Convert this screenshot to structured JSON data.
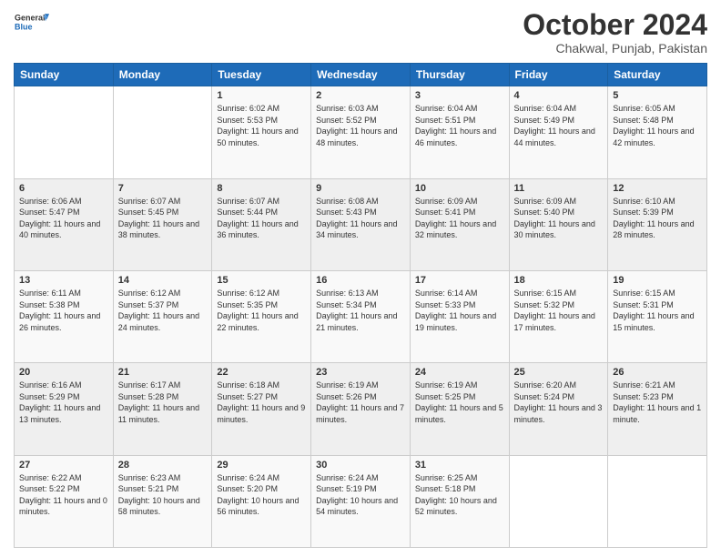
{
  "header": {
    "logo_general": "General",
    "logo_blue": "Blue",
    "month_title": "October 2024",
    "location": "Chakwal, Punjab, Pakistan"
  },
  "weekdays": [
    "Sunday",
    "Monday",
    "Tuesday",
    "Wednesday",
    "Thursday",
    "Friday",
    "Saturday"
  ],
  "weeks": [
    [
      {
        "day": "",
        "sunrise": "",
        "sunset": "",
        "daylight": ""
      },
      {
        "day": "",
        "sunrise": "",
        "sunset": "",
        "daylight": ""
      },
      {
        "day": "1",
        "sunrise": "Sunrise: 6:02 AM",
        "sunset": "Sunset: 5:53 PM",
        "daylight": "Daylight: 11 hours and 50 minutes."
      },
      {
        "day": "2",
        "sunrise": "Sunrise: 6:03 AM",
        "sunset": "Sunset: 5:52 PM",
        "daylight": "Daylight: 11 hours and 48 minutes."
      },
      {
        "day": "3",
        "sunrise": "Sunrise: 6:04 AM",
        "sunset": "Sunset: 5:51 PM",
        "daylight": "Daylight: 11 hours and 46 minutes."
      },
      {
        "day": "4",
        "sunrise": "Sunrise: 6:04 AM",
        "sunset": "Sunset: 5:49 PM",
        "daylight": "Daylight: 11 hours and 44 minutes."
      },
      {
        "day": "5",
        "sunrise": "Sunrise: 6:05 AM",
        "sunset": "Sunset: 5:48 PM",
        "daylight": "Daylight: 11 hours and 42 minutes."
      }
    ],
    [
      {
        "day": "6",
        "sunrise": "Sunrise: 6:06 AM",
        "sunset": "Sunset: 5:47 PM",
        "daylight": "Daylight: 11 hours and 40 minutes."
      },
      {
        "day": "7",
        "sunrise": "Sunrise: 6:07 AM",
        "sunset": "Sunset: 5:45 PM",
        "daylight": "Daylight: 11 hours and 38 minutes."
      },
      {
        "day": "8",
        "sunrise": "Sunrise: 6:07 AM",
        "sunset": "Sunset: 5:44 PM",
        "daylight": "Daylight: 11 hours and 36 minutes."
      },
      {
        "day": "9",
        "sunrise": "Sunrise: 6:08 AM",
        "sunset": "Sunset: 5:43 PM",
        "daylight": "Daylight: 11 hours and 34 minutes."
      },
      {
        "day": "10",
        "sunrise": "Sunrise: 6:09 AM",
        "sunset": "Sunset: 5:41 PM",
        "daylight": "Daylight: 11 hours and 32 minutes."
      },
      {
        "day": "11",
        "sunrise": "Sunrise: 6:09 AM",
        "sunset": "Sunset: 5:40 PM",
        "daylight": "Daylight: 11 hours and 30 minutes."
      },
      {
        "day": "12",
        "sunrise": "Sunrise: 6:10 AM",
        "sunset": "Sunset: 5:39 PM",
        "daylight": "Daylight: 11 hours and 28 minutes."
      }
    ],
    [
      {
        "day": "13",
        "sunrise": "Sunrise: 6:11 AM",
        "sunset": "Sunset: 5:38 PM",
        "daylight": "Daylight: 11 hours and 26 minutes."
      },
      {
        "day": "14",
        "sunrise": "Sunrise: 6:12 AM",
        "sunset": "Sunset: 5:37 PM",
        "daylight": "Daylight: 11 hours and 24 minutes."
      },
      {
        "day": "15",
        "sunrise": "Sunrise: 6:12 AM",
        "sunset": "Sunset: 5:35 PM",
        "daylight": "Daylight: 11 hours and 22 minutes."
      },
      {
        "day": "16",
        "sunrise": "Sunrise: 6:13 AM",
        "sunset": "Sunset: 5:34 PM",
        "daylight": "Daylight: 11 hours and 21 minutes."
      },
      {
        "day": "17",
        "sunrise": "Sunrise: 6:14 AM",
        "sunset": "Sunset: 5:33 PM",
        "daylight": "Daylight: 11 hours and 19 minutes."
      },
      {
        "day": "18",
        "sunrise": "Sunrise: 6:15 AM",
        "sunset": "Sunset: 5:32 PM",
        "daylight": "Daylight: 11 hours and 17 minutes."
      },
      {
        "day": "19",
        "sunrise": "Sunrise: 6:15 AM",
        "sunset": "Sunset: 5:31 PM",
        "daylight": "Daylight: 11 hours and 15 minutes."
      }
    ],
    [
      {
        "day": "20",
        "sunrise": "Sunrise: 6:16 AM",
        "sunset": "Sunset: 5:29 PM",
        "daylight": "Daylight: 11 hours and 13 minutes."
      },
      {
        "day": "21",
        "sunrise": "Sunrise: 6:17 AM",
        "sunset": "Sunset: 5:28 PM",
        "daylight": "Daylight: 11 hours and 11 minutes."
      },
      {
        "day": "22",
        "sunrise": "Sunrise: 6:18 AM",
        "sunset": "Sunset: 5:27 PM",
        "daylight": "Daylight: 11 hours and 9 minutes."
      },
      {
        "day": "23",
        "sunrise": "Sunrise: 6:19 AM",
        "sunset": "Sunset: 5:26 PM",
        "daylight": "Daylight: 11 hours and 7 minutes."
      },
      {
        "day": "24",
        "sunrise": "Sunrise: 6:19 AM",
        "sunset": "Sunset: 5:25 PM",
        "daylight": "Daylight: 11 hours and 5 minutes."
      },
      {
        "day": "25",
        "sunrise": "Sunrise: 6:20 AM",
        "sunset": "Sunset: 5:24 PM",
        "daylight": "Daylight: 11 hours and 3 minutes."
      },
      {
        "day": "26",
        "sunrise": "Sunrise: 6:21 AM",
        "sunset": "Sunset: 5:23 PM",
        "daylight": "Daylight: 11 hours and 1 minute."
      }
    ],
    [
      {
        "day": "27",
        "sunrise": "Sunrise: 6:22 AM",
        "sunset": "Sunset: 5:22 PM",
        "daylight": "Daylight: 11 hours and 0 minutes."
      },
      {
        "day": "28",
        "sunrise": "Sunrise: 6:23 AM",
        "sunset": "Sunset: 5:21 PM",
        "daylight": "Daylight: 10 hours and 58 minutes."
      },
      {
        "day": "29",
        "sunrise": "Sunrise: 6:24 AM",
        "sunset": "Sunset: 5:20 PM",
        "daylight": "Daylight: 10 hours and 56 minutes."
      },
      {
        "day": "30",
        "sunrise": "Sunrise: 6:24 AM",
        "sunset": "Sunset: 5:19 PM",
        "daylight": "Daylight: 10 hours and 54 minutes."
      },
      {
        "day": "31",
        "sunrise": "Sunrise: 6:25 AM",
        "sunset": "Sunset: 5:18 PM",
        "daylight": "Daylight: 10 hours and 52 minutes."
      },
      {
        "day": "",
        "sunrise": "",
        "sunset": "",
        "daylight": ""
      },
      {
        "day": "",
        "sunrise": "",
        "sunset": "",
        "daylight": ""
      }
    ]
  ]
}
